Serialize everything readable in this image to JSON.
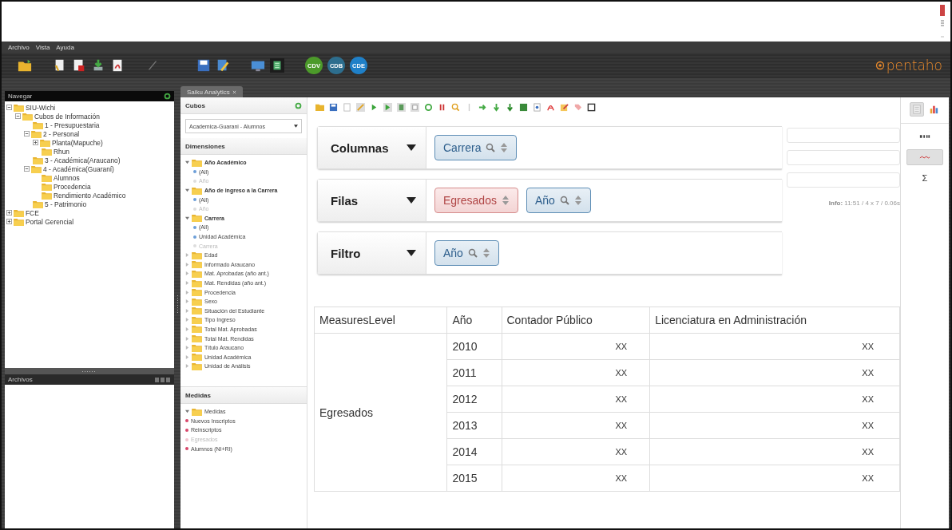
{
  "menu": [
    "Archivo",
    "Vista",
    "Ayuda"
  ],
  "toolbar_badges": [
    {
      "label": "CDV",
      "color": "#4c9a2a"
    },
    {
      "label": "CDB",
      "color": "#2d6e8e"
    },
    {
      "label": "CDE",
      "color": "#1f80c8"
    }
  ],
  "logo": "pentaho",
  "navigator": {
    "title": "Navegar",
    "tree": [
      {
        "label": "SIU-Wichi",
        "expanded": true,
        "children": [
          {
            "label": "Cubos de Información",
            "expanded": true,
            "children": [
              {
                "label": "1 - Presupuestaria"
              },
              {
                "label": "2 - Personal",
                "expanded": true,
                "children": [
                  {
                    "label": "Planta(Mapuche)",
                    "expanded": false
                  },
                  {
                    "label": "Rhun"
                  }
                ]
              },
              {
                "label": "3 - Académica(Araucano)"
              },
              {
                "label": "4 - Académica(Guaraní)",
                "expanded": true,
                "children": [
                  {
                    "label": "Alumnos"
                  },
                  {
                    "label": "Procedencia"
                  },
                  {
                    "label": "Rendimiento Académico"
                  }
                ]
              },
              {
                "label": "5 - Patrimonio"
              }
            ]
          }
        ]
      },
      {
        "label": "FCE",
        "expanded": false
      },
      {
        "label": "Portal Gerencial",
        "expanded": false
      }
    ]
  },
  "files_panel": {
    "title": "Archivos"
  },
  "tab": {
    "label": "Saiku Analytics"
  },
  "cubes": {
    "title": "Cubos",
    "selected_cube": "Academica-Guarani - Alumnos"
  },
  "dimensions": {
    "title": "Dimensiones",
    "items": [
      {
        "label": "Año Académico",
        "expanded": true,
        "children": [
          {
            "label": "(All)",
            "used": false
          },
          {
            "label": "Año",
            "used": true
          }
        ]
      },
      {
        "label": "Año de ingreso a la Carrera",
        "expanded": true,
        "children": [
          {
            "label": "(All)",
            "used": false
          },
          {
            "label": "Año",
            "used": true
          }
        ]
      },
      {
        "label": "Carrera",
        "expanded": true,
        "children": [
          {
            "label": "(All)",
            "used": false
          },
          {
            "label": "Unidad Académica",
            "used": false
          },
          {
            "label": "Carrera",
            "used": true
          }
        ]
      },
      {
        "label": "Edad",
        "expanded": false
      },
      {
        "label": "Informado Araucano",
        "expanded": false
      },
      {
        "label": "Mat. Aprobadas (año ant.)",
        "expanded": false
      },
      {
        "label": "Mat. Rendidas (año ant.)",
        "expanded": false
      },
      {
        "label": "Procedencia",
        "expanded": false
      },
      {
        "label": "Sexo",
        "expanded": false
      },
      {
        "label": "Situación del Estudiante",
        "expanded": false
      },
      {
        "label": "Tipo Ingreso",
        "expanded": false
      },
      {
        "label": "Total Mat. Aprobadas",
        "expanded": false
      },
      {
        "label": "Total Mat. Rendidas",
        "expanded": false
      },
      {
        "label": "Título Araucano",
        "expanded": false
      },
      {
        "label": "Unidad Académica",
        "expanded": false
      },
      {
        "label": "Unidad de Análisis",
        "expanded": false
      }
    ]
  },
  "measures": {
    "title": "Medidas",
    "group": {
      "label": "Medidas",
      "expanded": true
    },
    "items": [
      {
        "label": "Nuevos Inscriptos",
        "used": false
      },
      {
        "label": "Reinscriptos",
        "used": false
      },
      {
        "label": "Egresados",
        "used": true
      },
      {
        "label": "Alumnos (NI+RI)",
        "used": false
      }
    ]
  },
  "drop_zones": [
    {
      "label": "Columnas",
      "chips": [
        {
          "label": "Carrera",
          "kind": "dimension"
        }
      ]
    },
    {
      "label": "Filas",
      "chips": [
        {
          "label": "Egresados",
          "kind": "measure"
        },
        {
          "label": "Año",
          "kind": "dimension"
        }
      ]
    },
    {
      "label": "Filtro",
      "chips": [
        {
          "label": "Año",
          "kind": "dimension"
        }
      ]
    }
  ],
  "info": "**Info:** 11:51  / 4 x 7 / 0.06s",
  "table": {
    "columns": [
      "MeasuresLevel",
      "Año",
      "Contador Público",
      "Licenciatura en Administración"
    ],
    "group": "Egresados",
    "rows": [
      {
        "year": "2010",
        "values": [
          "XX",
          "XX"
        ]
      },
      {
        "year": "2011",
        "values": [
          "XX",
          "XX"
        ]
      },
      {
        "year": "2012",
        "values": [
          "XX",
          "XX"
        ]
      },
      {
        "year": "2013",
        "values": [
          "XX",
          "XX"
        ]
      },
      {
        "year": "2014",
        "values": [
          "XX",
          "XX"
        ]
      },
      {
        "year": "2015",
        "values": [
          "XX",
          "XX"
        ]
      }
    ]
  },
  "view_modes": [
    {
      "kind": "table",
      "selected": true
    },
    {
      "kind": "chart",
      "selected": false
    }
  ],
  "side_tools": [
    {
      "kind": "bold",
      "selected": false
    },
    {
      "kind": "squiggle",
      "selected": true
    },
    {
      "kind": "sum",
      "label": "Σ",
      "selected": false
    }
  ]
}
